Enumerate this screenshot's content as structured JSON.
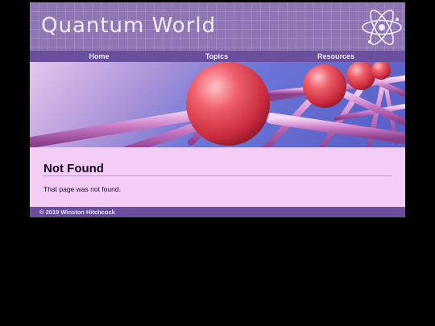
{
  "header": {
    "title": "Quantum World",
    "logo_icon": "atom-icon"
  },
  "nav": {
    "items": [
      "Home",
      "Topics",
      "Resources"
    ]
  },
  "content": {
    "heading": "Not Found",
    "message": "That page was not found."
  },
  "footer": {
    "copyright": "© 2019 Winston Hitchcock"
  },
  "colors": {
    "header_bg": "#8f75b4",
    "nav_bg": "#6a4f9e",
    "page_bg": "#f4cdf6",
    "background": "#000000"
  }
}
